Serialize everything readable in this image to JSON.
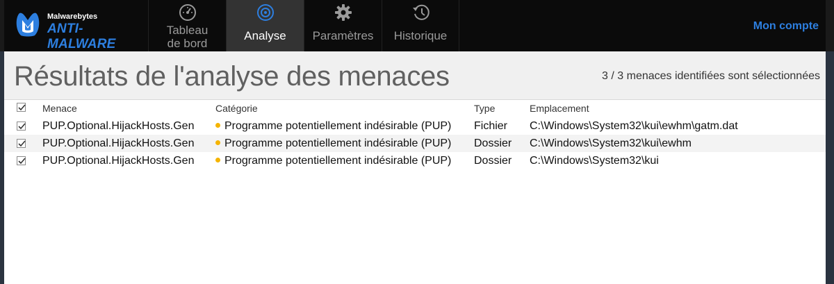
{
  "app": {
    "logo_small": "Malwarebytes",
    "logo_big": "ANTI-MALWARE",
    "brand_color": "#2d7fe0"
  },
  "nav": {
    "items": [
      {
        "label_line1": "Tableau",
        "label_line2": "de bord",
        "icon": "gauge-icon",
        "active": false
      },
      {
        "label_line1": "Analyse",
        "icon": "scan-target-icon",
        "active": true
      },
      {
        "label_line1": "Paramètres",
        "icon": "gear-icon",
        "active": false
      },
      {
        "label_line1": "Historique",
        "icon": "history-clock-icon",
        "active": false
      }
    ],
    "account": "Mon compte"
  },
  "page": {
    "title": "Résultats de l'analyse des menaces",
    "selection_status": "3 / 3 menaces identifiées sont sélectionnées"
  },
  "table": {
    "columns": {
      "threat": "Menace",
      "category": "Catégorie",
      "type": "Type",
      "location": "Emplacement"
    },
    "rows": [
      {
        "checked": true,
        "threat": "PUP.Optional.HijackHosts.Gen",
        "category": "Programme potentiellement indésirable (PUP)",
        "category_color": "#f5b400",
        "type": "Fichier",
        "location": "C:\\Windows\\System32\\kui\\ewhm\\gatm.dat"
      },
      {
        "checked": true,
        "threat": "PUP.Optional.HijackHosts.Gen",
        "category": "Programme potentiellement indésirable (PUP)",
        "category_color": "#f5b400",
        "type": "Dossier",
        "location": "C:\\Windows\\System32\\kui\\ewhm"
      },
      {
        "checked": true,
        "threat": "PUP.Optional.HijackHosts.Gen",
        "category": "Programme potentiellement indésirable (PUP)",
        "category_color": "#f5b400",
        "type": "Dossier",
        "location": "C:\\Windows\\System32\\kui"
      }
    ]
  }
}
